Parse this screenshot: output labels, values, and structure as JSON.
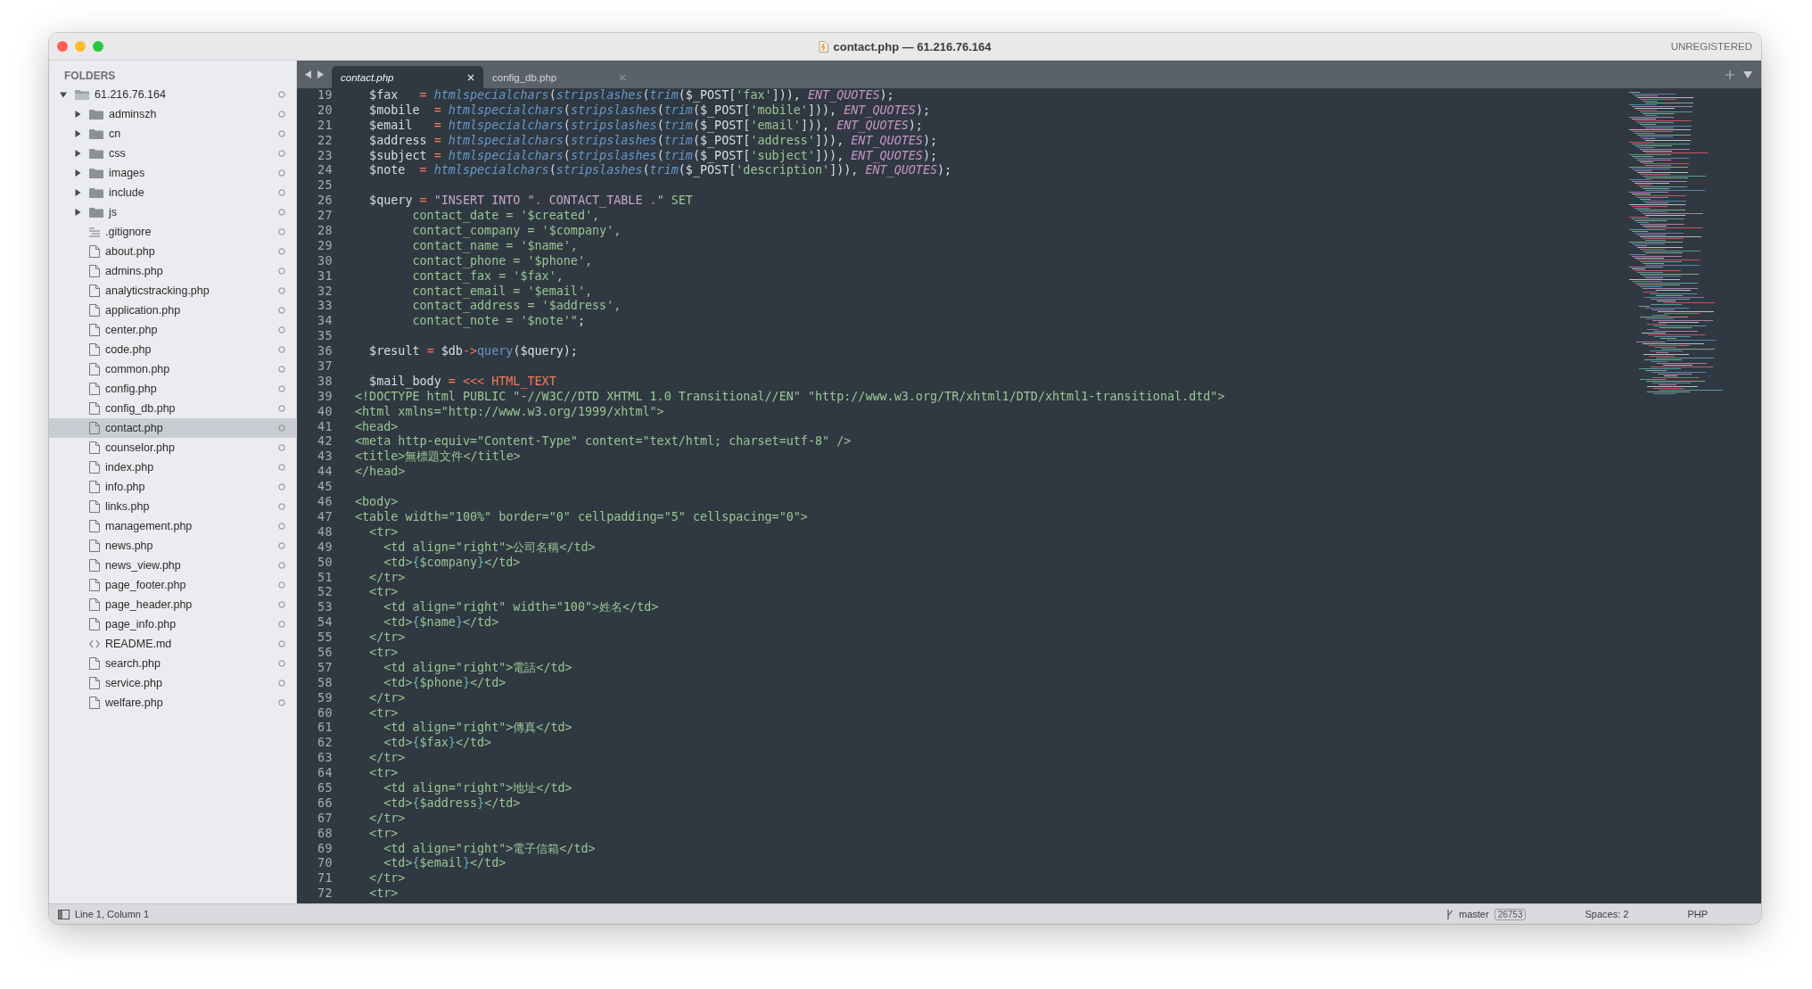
{
  "window": {
    "title": "contact.php — 61.216.76.164",
    "license": "UNREGISTERED"
  },
  "sidebar": {
    "heading": "FOLDERS",
    "tree": [
      {
        "name": "61.216.76.164",
        "kind": "folder",
        "expanded": true,
        "selected": false,
        "children": [
          {
            "name": "adminszh",
            "kind": "folder",
            "expanded": false,
            "selected": false
          },
          {
            "name": "cn",
            "kind": "folder",
            "expanded": false,
            "selected": false
          },
          {
            "name": "css",
            "kind": "folder",
            "expanded": false,
            "selected": false
          },
          {
            "name": "images",
            "kind": "folder",
            "expanded": false,
            "selected": false
          },
          {
            "name": "include",
            "kind": "folder",
            "expanded": false,
            "selected": false
          },
          {
            "name": "js",
            "kind": "folder",
            "expanded": false,
            "selected": false
          },
          {
            "name": ".gitignore",
            "kind": "text",
            "selected": false
          },
          {
            "name": "about.php",
            "kind": "file",
            "selected": false
          },
          {
            "name": "admins.php",
            "kind": "file",
            "selected": false
          },
          {
            "name": "analyticstracking.php",
            "kind": "file",
            "selected": false
          },
          {
            "name": "application.php",
            "kind": "file",
            "selected": false
          },
          {
            "name": "center.php",
            "kind": "file",
            "selected": false
          },
          {
            "name": "code.php",
            "kind": "file",
            "selected": false
          },
          {
            "name": "common.php",
            "kind": "file",
            "selected": false
          },
          {
            "name": "config.php",
            "kind": "file",
            "selected": false
          },
          {
            "name": "config_db.php",
            "kind": "file",
            "selected": false
          },
          {
            "name": "contact.php",
            "kind": "file",
            "selected": true
          },
          {
            "name": "counselor.php",
            "kind": "file",
            "selected": false
          },
          {
            "name": "index.php",
            "kind": "file",
            "selected": false
          },
          {
            "name": "info.php",
            "kind": "file",
            "selected": false
          },
          {
            "name": "links.php",
            "kind": "file",
            "selected": false
          },
          {
            "name": "management.php",
            "kind": "file",
            "selected": false
          },
          {
            "name": "news.php",
            "kind": "file",
            "selected": false
          },
          {
            "name": "news_view.php",
            "kind": "file",
            "selected": false
          },
          {
            "name": "page_footer.php",
            "kind": "file",
            "selected": false
          },
          {
            "name": "page_header.php",
            "kind": "file",
            "selected": false
          },
          {
            "name": "page_info.php",
            "kind": "file",
            "selected": false
          },
          {
            "name": "README.md",
            "kind": "markup",
            "selected": false
          },
          {
            "name": "search.php",
            "kind": "file",
            "selected": false
          },
          {
            "name": "service.php",
            "kind": "file",
            "selected": false
          },
          {
            "name": "welfare.php",
            "kind": "file",
            "selected": false
          }
        ]
      }
    ]
  },
  "tabs": [
    {
      "label": "contact.php",
      "selected": true
    },
    {
      "label": "config_db.php",
      "selected": false
    }
  ],
  "editor": {
    "lines": [
      {
        "number": "19",
        "tokens": [
          {
            "kind": "plain",
            "text": "  $fax   "
          },
          {
            "kind": "op",
            "text": "= "
          },
          {
            "kind": "func",
            "text": "htmlspecialchars"
          },
          {
            "kind": "plain",
            "text": "("
          },
          {
            "kind": "func",
            "text": "stripslashes"
          },
          {
            "kind": "plain",
            "text": "("
          },
          {
            "kind": "func",
            "text": "trim"
          },
          {
            "kind": "plain",
            "text": "($_POST["
          },
          {
            "kind": "str",
            "text": "'fax'"
          },
          {
            "kind": "plain",
            "text": "])), "
          },
          {
            "kind": "const",
            "text": "ENT_QUOTES"
          },
          {
            "kind": "plain",
            "text": ");"
          }
        ]
      },
      {
        "number": "20",
        "tokens": [
          {
            "kind": "plain",
            "text": "  $mobile  "
          },
          {
            "kind": "op",
            "text": "= "
          },
          {
            "kind": "func",
            "text": "htmlspecialchars"
          },
          {
            "kind": "plain",
            "text": "("
          },
          {
            "kind": "func",
            "text": "stripslashes"
          },
          {
            "kind": "plain",
            "text": "("
          },
          {
            "kind": "func",
            "text": "trim"
          },
          {
            "kind": "plain",
            "text": "($_POST["
          },
          {
            "kind": "str",
            "text": "'mobile'"
          },
          {
            "kind": "plain",
            "text": "])), "
          },
          {
            "kind": "const",
            "text": "ENT_QUOTES"
          },
          {
            "kind": "plain",
            "text": ");"
          }
        ]
      },
      {
        "number": "21",
        "tokens": [
          {
            "kind": "plain",
            "text": "  $email   "
          },
          {
            "kind": "op",
            "text": "= "
          },
          {
            "kind": "func",
            "text": "htmlspecialchars"
          },
          {
            "kind": "plain",
            "text": "("
          },
          {
            "kind": "func",
            "text": "stripslashes"
          },
          {
            "kind": "plain",
            "text": "("
          },
          {
            "kind": "func",
            "text": "trim"
          },
          {
            "kind": "plain",
            "text": "($_POST["
          },
          {
            "kind": "str",
            "text": "'email'"
          },
          {
            "kind": "plain",
            "text": "])), "
          },
          {
            "kind": "const",
            "text": "ENT_QUOTES"
          },
          {
            "kind": "plain",
            "text": ");"
          }
        ]
      },
      {
        "number": "22",
        "tokens": [
          {
            "kind": "plain",
            "text": "  $address "
          },
          {
            "kind": "op",
            "text": "= "
          },
          {
            "kind": "func",
            "text": "htmlspecialchars"
          },
          {
            "kind": "plain",
            "text": "("
          },
          {
            "kind": "func",
            "text": "stripslashes"
          },
          {
            "kind": "plain",
            "text": "("
          },
          {
            "kind": "func",
            "text": "trim"
          },
          {
            "kind": "plain",
            "text": "($_POST["
          },
          {
            "kind": "str",
            "text": "'address'"
          },
          {
            "kind": "plain",
            "text": "])), "
          },
          {
            "kind": "const",
            "text": "ENT_QUOTES"
          },
          {
            "kind": "plain",
            "text": ");"
          }
        ]
      },
      {
        "number": "23",
        "tokens": [
          {
            "kind": "plain",
            "text": "  $subject "
          },
          {
            "kind": "op",
            "text": "= "
          },
          {
            "kind": "func",
            "text": "htmlspecialchars"
          },
          {
            "kind": "plain",
            "text": "("
          },
          {
            "kind": "func",
            "text": "stripslashes"
          },
          {
            "kind": "plain",
            "text": "("
          },
          {
            "kind": "func",
            "text": "trim"
          },
          {
            "kind": "plain",
            "text": "($_POST["
          },
          {
            "kind": "str",
            "text": "'subject'"
          },
          {
            "kind": "plain",
            "text": "])), "
          },
          {
            "kind": "const",
            "text": "ENT_QUOTES"
          },
          {
            "kind": "plain",
            "text": ");"
          }
        ]
      },
      {
        "number": "24",
        "tokens": [
          {
            "kind": "plain",
            "text": "  $note  "
          },
          {
            "kind": "op",
            "text": "= "
          },
          {
            "kind": "func",
            "text": "htmlspecialchars"
          },
          {
            "kind": "plain",
            "text": "("
          },
          {
            "kind": "func",
            "text": "stripslashes"
          },
          {
            "kind": "plain",
            "text": "("
          },
          {
            "kind": "func",
            "text": "trim"
          },
          {
            "kind": "plain",
            "text": "($_POST["
          },
          {
            "kind": "str",
            "text": "'description'"
          },
          {
            "kind": "plain",
            "text": "])), "
          },
          {
            "kind": "const",
            "text": "ENT_QUOTES"
          },
          {
            "kind": "plain",
            "text": ");"
          }
        ]
      },
      {
        "number": "25"
      },
      {
        "number": "26",
        "tokens": [
          {
            "kind": "plain",
            "text": "  $query "
          },
          {
            "kind": "op",
            "text": "= "
          },
          {
            "kind": "str2",
            "text": "\"INSERT INTO \""
          },
          {
            "kind": "op",
            "text": ". "
          },
          {
            "kind": "str2",
            "text": "CONTACT_TABLE "
          },
          {
            "kind": "op",
            "text": "."
          },
          {
            "kind": "str",
            "text": "\" SET"
          }
        ]
      },
      {
        "number": "27",
        "tokens": [
          {
            "kind": "str",
            "text": "        contact_date = '$created',"
          }
        ]
      },
      {
        "number": "28",
        "tokens": [
          {
            "kind": "str",
            "text": "        contact_company = '$company',"
          }
        ]
      },
      {
        "number": "29",
        "tokens": [
          {
            "kind": "str",
            "text": "        contact_name = '$name',"
          }
        ]
      },
      {
        "number": "30",
        "tokens": [
          {
            "kind": "str",
            "text": "        contact_phone = '$phone',"
          }
        ]
      },
      {
        "number": "31",
        "tokens": [
          {
            "kind": "str",
            "text": "        contact_fax = '$fax',"
          }
        ]
      },
      {
        "number": "32",
        "tokens": [
          {
            "kind": "str",
            "text": "        contact_email = '$email',"
          }
        ]
      },
      {
        "number": "33",
        "tokens": [
          {
            "kind": "str",
            "text": "        contact_address = '$address',"
          }
        ]
      },
      {
        "number": "34",
        "tokens": [
          {
            "kind": "str",
            "text": "        contact_note = '$note'\""
          },
          {
            "kind": "plain",
            "text": ";"
          }
        ]
      },
      {
        "number": "35"
      },
      {
        "number": "36",
        "tokens": [
          {
            "kind": "plain",
            "text": "  $result "
          },
          {
            "kind": "op",
            "text": "="
          },
          {
            "kind": "plain",
            "text": " $db"
          },
          {
            "kind": "op",
            "text": "->"
          },
          {
            "kind": "method",
            "text": "query"
          },
          {
            "kind": "plain",
            "text": "($query);"
          }
        ]
      },
      {
        "number": "37"
      },
      {
        "number": "38",
        "tokens": [
          {
            "kind": "plain",
            "text": "  $mail_body "
          },
          {
            "kind": "op",
            "text": "= <<< HTML_TEXT"
          }
        ]
      },
      {
        "number": "39",
        "tokens": [
          {
            "kind": "markup",
            "text": "<!DOCTYPE html PUBLIC \"-//W3C//DTD XHTML 1.0 Transitional//EN\" \"http://www.w3.org/TR/xhtml1/DTD/xhtml1-transitional.dtd\">"
          }
        ]
      },
      {
        "number": "40",
        "tokens": [
          {
            "kind": "markup",
            "text": "<html xmlns=\"http://www.w3.org/1999/xhtml\">"
          }
        ]
      },
      {
        "number": "41",
        "tokens": [
          {
            "kind": "markup",
            "text": "<head>"
          }
        ]
      },
      {
        "number": "42",
        "tokens": [
          {
            "kind": "markup",
            "text": "<meta http-equiv=\"Content-Type\" content=\"text/html; charset=utf-8\" />"
          }
        ]
      },
      {
        "number": "43",
        "tokens": [
          {
            "kind": "markup",
            "text": "<title>無標題文件</title>"
          }
        ]
      },
      {
        "number": "44",
        "tokens": [
          {
            "kind": "markup",
            "text": "</head>"
          }
        ]
      },
      {
        "number": "45"
      },
      {
        "number": "46",
        "tokens": [
          {
            "kind": "markup",
            "text": "<body>"
          }
        ]
      },
      {
        "number": "47",
        "tokens": [
          {
            "kind": "markup",
            "text": "<table width=\"100%\" border=\"0\" cellpadding=\"5\" cellspacing=\"0\">"
          }
        ]
      },
      {
        "number": "48",
        "tokens": [
          {
            "kind": "markup",
            "text": "  <tr>"
          }
        ]
      },
      {
        "number": "49",
        "tokens": [
          {
            "kind": "markup",
            "text": "    <td align=\"right\">公司名稱</td>"
          }
        ]
      },
      {
        "number": "50",
        "tokens": [
          {
            "kind": "markup",
            "text": "    <td>"
          },
          {
            "kind": "brace",
            "text": "{"
          },
          {
            "kind": "markup",
            "text": "$company"
          },
          {
            "kind": "brace",
            "text": "}"
          },
          {
            "kind": "markup",
            "text": "</td>"
          }
        ]
      },
      {
        "number": "51",
        "tokens": [
          {
            "kind": "markup",
            "text": "  </tr>"
          }
        ]
      },
      {
        "number": "52",
        "tokens": [
          {
            "kind": "markup",
            "text": "  <tr>"
          }
        ]
      },
      {
        "number": "53",
        "tokens": [
          {
            "kind": "markup",
            "text": "    <td align=\"right\" width=\"100\">姓名</td>"
          }
        ]
      },
      {
        "number": "54",
        "tokens": [
          {
            "kind": "markup",
            "text": "    <td>"
          },
          {
            "kind": "brace",
            "text": "{"
          },
          {
            "kind": "markup",
            "text": "$name"
          },
          {
            "kind": "brace",
            "text": "}"
          },
          {
            "kind": "markup",
            "text": "</td>"
          }
        ]
      },
      {
        "number": "55",
        "tokens": [
          {
            "kind": "markup",
            "text": "  </tr>"
          }
        ]
      },
      {
        "number": "56",
        "tokens": [
          {
            "kind": "markup",
            "text": "  <tr>"
          }
        ]
      },
      {
        "number": "57",
        "tokens": [
          {
            "kind": "markup",
            "text": "    <td align=\"right\">電話</td>"
          }
        ]
      },
      {
        "number": "58",
        "tokens": [
          {
            "kind": "markup",
            "text": "    <td>"
          },
          {
            "kind": "brace",
            "text": "{"
          },
          {
            "kind": "markup",
            "text": "$phone"
          },
          {
            "kind": "brace",
            "text": "}"
          },
          {
            "kind": "markup",
            "text": "</td>"
          }
        ]
      },
      {
        "number": "59",
        "tokens": [
          {
            "kind": "markup",
            "text": "  </tr>"
          }
        ]
      },
      {
        "number": "60",
        "tokens": [
          {
            "kind": "markup",
            "text": "  <tr>"
          }
        ]
      },
      {
        "number": "61",
        "tokens": [
          {
            "kind": "markup",
            "text": "    <td align=\"right\">傳真</td>"
          }
        ]
      },
      {
        "number": "62",
        "tokens": [
          {
            "kind": "markup",
            "text": "    <td>"
          },
          {
            "kind": "brace",
            "text": "{"
          },
          {
            "kind": "markup",
            "text": "$fax"
          },
          {
            "kind": "brace",
            "text": "}"
          },
          {
            "kind": "markup",
            "text": "</td>"
          }
        ]
      },
      {
        "number": "63",
        "tokens": [
          {
            "kind": "markup",
            "text": "  </tr>"
          }
        ]
      },
      {
        "number": "64",
        "tokens": [
          {
            "kind": "markup",
            "text": "  <tr>"
          }
        ]
      },
      {
        "number": "65",
        "tokens": [
          {
            "kind": "markup",
            "text": "    <td align=\"right\">地址</td>"
          }
        ]
      },
      {
        "number": "66",
        "tokens": [
          {
            "kind": "markup",
            "text": "    <td>"
          },
          {
            "kind": "brace",
            "text": "{"
          },
          {
            "kind": "markup",
            "text": "$address"
          },
          {
            "kind": "brace",
            "text": "}"
          },
          {
            "kind": "markup",
            "text": "</td>"
          }
        ]
      },
      {
        "number": "67",
        "tokens": [
          {
            "kind": "markup",
            "text": "  </tr>"
          }
        ]
      },
      {
        "number": "68",
        "tokens": [
          {
            "kind": "markup",
            "text": "  <tr>"
          }
        ]
      },
      {
        "number": "69",
        "tokens": [
          {
            "kind": "markup",
            "text": "    <td align=\"right\">電子信箱</td>"
          }
        ]
      },
      {
        "number": "70",
        "tokens": [
          {
            "kind": "markup",
            "text": "    <td>"
          },
          {
            "kind": "brace",
            "text": "{"
          },
          {
            "kind": "markup",
            "text": "$email"
          },
          {
            "kind": "brace",
            "text": "}"
          },
          {
            "kind": "markup",
            "text": "</td>"
          }
        ]
      },
      {
        "number": "71",
        "tokens": [
          {
            "kind": "markup",
            "text": "  </tr>"
          }
        ]
      },
      {
        "number": "72",
        "tokens": [
          {
            "kind": "markup",
            "text": "  <tr>"
          }
        ]
      }
    ]
  },
  "status_bar": {
    "position": "Line 1, Column 1",
    "branch": "master",
    "changes": "26753",
    "indentation": "Spaces: 2",
    "syntax": "PHP"
  }
}
